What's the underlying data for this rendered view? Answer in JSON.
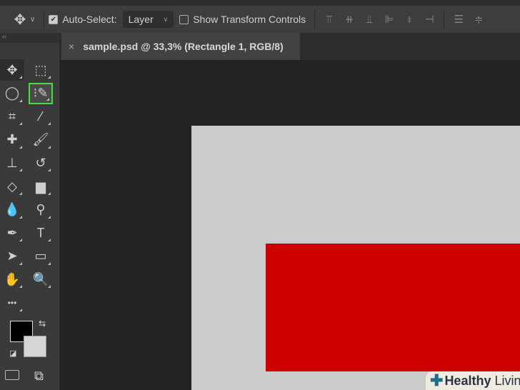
{
  "options_bar": {
    "auto_select_label": "Auto-Select:",
    "auto_select_checked": true,
    "layer_dropdown": "Layer",
    "show_transform_label": "Show Transform Controls",
    "show_transform_checked": false
  },
  "document_tab": {
    "title": "sample.psd @ 33,3% (Rectangle 1, RGB/8)",
    "close": "×"
  },
  "tools": [
    {
      "name": "move-tool",
      "glyph": "✥"
    },
    {
      "name": "marquee-tool",
      "glyph": "⬚"
    },
    {
      "name": "lasso-tool",
      "glyph": "◯"
    },
    {
      "name": "quick-selection-tool",
      "glyph": "⁝✎",
      "active": true
    },
    {
      "name": "crop-tool",
      "glyph": "⌗"
    },
    {
      "name": "eyedropper-tool",
      "glyph": "⁄"
    },
    {
      "name": "healing-brush-tool",
      "glyph": "✚"
    },
    {
      "name": "brush-tool",
      "glyph": "🖌"
    },
    {
      "name": "clone-stamp-tool",
      "glyph": "⊥"
    },
    {
      "name": "history-brush-tool",
      "glyph": "↺"
    },
    {
      "name": "eraser-tool",
      "glyph": "◇"
    },
    {
      "name": "gradient-tool",
      "glyph": "▆"
    },
    {
      "name": "blur-tool",
      "glyph": "💧"
    },
    {
      "name": "dodge-tool",
      "glyph": "⚲"
    },
    {
      "name": "pen-tool",
      "glyph": "✒"
    },
    {
      "name": "type-tool",
      "glyph": "T"
    },
    {
      "name": "path-selection-tool",
      "glyph": "➤"
    },
    {
      "name": "rectangle-tool",
      "glyph": "▭"
    },
    {
      "name": "hand-tool",
      "glyph": "✋"
    },
    {
      "name": "zoom-tool",
      "glyph": "🔍"
    },
    {
      "name": "edit-toolbar",
      "glyph": "•••"
    }
  ],
  "colors": {
    "foreground": "#000000",
    "background": "#d5d5d5",
    "canvas": "#cbcbcb",
    "rectangle": "#cc0000",
    "highlight": "#3fe03f"
  },
  "watermark": {
    "brand": "Healthy",
    "suffix": "Living"
  }
}
